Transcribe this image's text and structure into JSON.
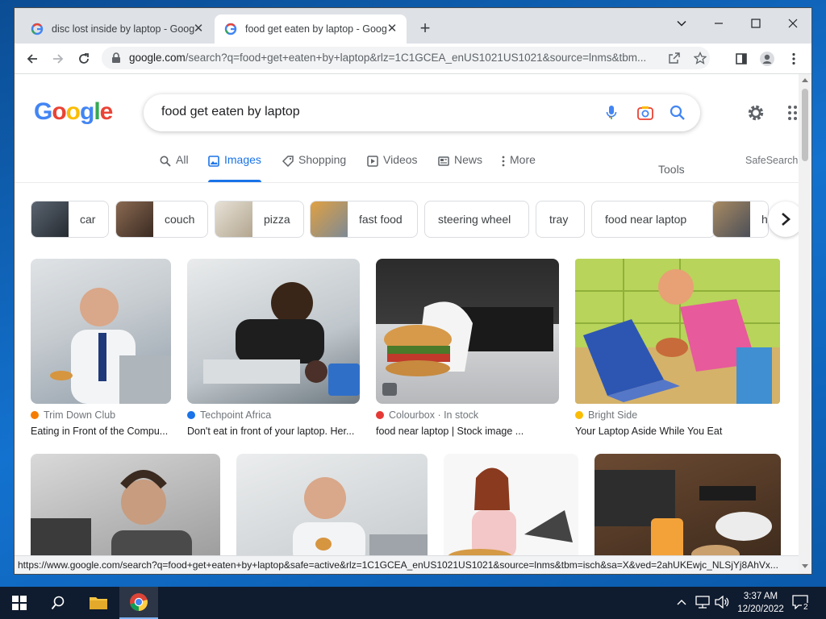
{
  "browser": {
    "tabs": [
      {
        "title": "disc lost inside by laptop - Goog",
        "active": false
      },
      {
        "title": "food get eaten by laptop - Goog",
        "active": true
      }
    ],
    "url_domain": "google.com",
    "url_rest": "/search?q=food+get+eaten+by+laptop&rlz=1C1GCEA_enUS1021US1021&source=lnms&tbm...",
    "status_url": "https://www.google.com/search?q=food+get+eaten+by+laptop&safe=active&rlz=1C1GCEA_enUS1021US1021&source=lnms&tbm=isch&sa=X&ved=2ahUKEwjc_NLSjYj8AhVx..."
  },
  "search": {
    "logo": "Google",
    "query": "food get eaten by laptop",
    "tabs": [
      {
        "label": "All",
        "icon": "search-icon"
      },
      {
        "label": "Images",
        "icon": "image-icon",
        "active": true
      },
      {
        "label": "Shopping",
        "icon": "tag-icon"
      },
      {
        "label": "Videos",
        "icon": "play-icon"
      },
      {
        "label": "News",
        "icon": "news-icon"
      },
      {
        "label": "More",
        "icon": "more-vert-icon"
      }
    ],
    "tools": "Tools",
    "safesearch": "SafeSearch"
  },
  "chips": [
    "car",
    "couch",
    "pizza",
    "fast food",
    "steering wheel",
    "tray",
    "food near laptop",
    "ha"
  ],
  "results_row1": [
    {
      "source": "Trim Down Club",
      "title": "Eating in Front of the Compu...",
      "fav_color": "#f57c00"
    },
    {
      "source": "Techpoint Africa",
      "title": "Don't eat in front of your laptop. Her...",
      "fav_color": "#1a73e8"
    },
    {
      "source": "Colourbox · In stock",
      "title": "food near laptop | Stock image ...",
      "fav_color": "#e53935"
    },
    {
      "source": "Bright Side",
      "title": "Your Laptop Aside While You Eat",
      "fav_color": "#fbbc04"
    }
  ],
  "taskbar": {
    "time": "3:37 AM",
    "date": "12/20/2022",
    "notifications": "2"
  },
  "colors": {
    "accent": "#1a73e8",
    "google_blue": "#4285f4",
    "google_red": "#ea4335",
    "google_yellow": "#fbbc05",
    "google_green": "#34a853"
  }
}
